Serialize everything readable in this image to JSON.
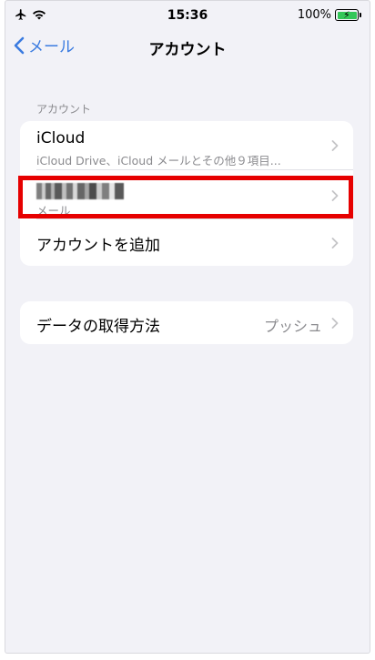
{
  "status_bar": {
    "time": "15:36",
    "battery_percent": "100%",
    "battery_level": 1.0,
    "icons": [
      "airplane-icon",
      "wifi-icon",
      "battery-charging-icon"
    ]
  },
  "nav": {
    "back_label": "メール",
    "title": "アカウント"
  },
  "accounts_section": {
    "header": "アカウント",
    "rows": [
      {
        "title": "iCloud",
        "subtitle": "iCloud Drive、iCloud メールとその他９項目..."
      },
      {
        "title": "",
        "title_redacted": true,
        "subtitle": "メール"
      },
      {
        "title": "アカウントを追加"
      }
    ]
  },
  "fetch_section": {
    "title": "データの取得方法",
    "value": "プッシュ"
  },
  "colors": {
    "accent": "#3a7be0",
    "highlight": "#e60000",
    "background": "#f2f2f7",
    "secondary_text": "#8a8a8e"
  }
}
